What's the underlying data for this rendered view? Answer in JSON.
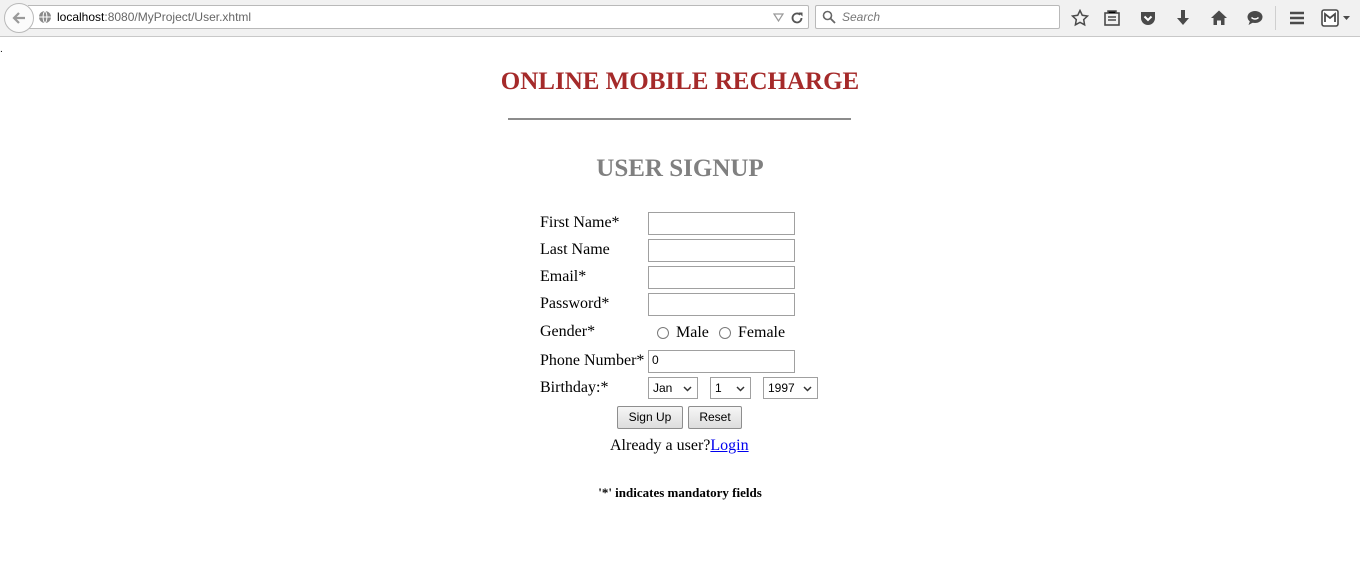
{
  "browser": {
    "url_host": "localhost",
    "url_rest": ":8080/MyProject/User.xhtml",
    "search_placeholder": "Search"
  },
  "page": {
    "site_title": "ONLINE MOBILE RECHARGE",
    "form_title": "USER SIGNUP",
    "fields": {
      "first_name_label": "First Name*",
      "last_name_label": "Last Name",
      "email_label": "Email*",
      "password_label": "Password*",
      "gender_label": "Gender*",
      "gender_male": "Male",
      "gender_female": "Female",
      "phone_label": "Phone Number*",
      "phone_value": "0",
      "birthday_label": "Birthday:*",
      "birth_month": "Jan",
      "birth_day": "1",
      "birth_year": "1997"
    },
    "buttons": {
      "signup": "Sign Up",
      "reset": "Reset"
    },
    "already_user": "Already a user?",
    "login_link": "Login",
    "mandatory_note": "'*' indicates mandatory fields",
    "dot": "."
  }
}
